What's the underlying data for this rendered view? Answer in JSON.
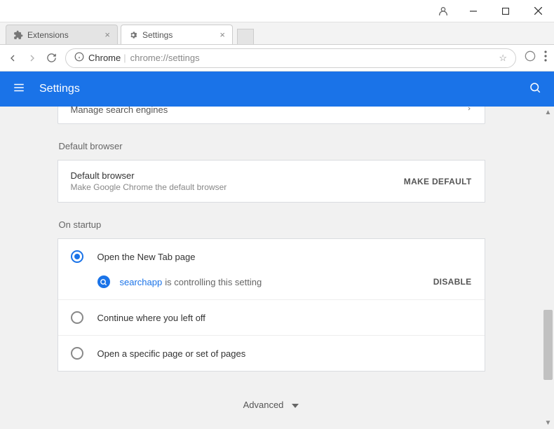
{
  "window": {
    "tabs": [
      {
        "label": "Extensions",
        "active": false
      },
      {
        "label": "Settings",
        "active": true
      }
    ],
    "omnibox": {
      "prefix": "Chrome",
      "path": "chrome://settings"
    }
  },
  "header": {
    "title": "Settings"
  },
  "truncated_row": {
    "label": "Manage search engines"
  },
  "sections": {
    "default_browser": {
      "heading": "Default browser",
      "title": "Default browser",
      "subtitle": "Make Google Chrome the default browser",
      "button": "MAKE DEFAULT"
    },
    "startup": {
      "heading": "On startup",
      "options": [
        "Open the New Tab page",
        "Continue where you left off",
        "Open a specific page or set of pages"
      ],
      "controlling": {
        "ext_name": "searchapp",
        "message": "is controlling this setting",
        "button": "DISABLE"
      }
    }
  },
  "advanced": {
    "label": "Advanced"
  }
}
